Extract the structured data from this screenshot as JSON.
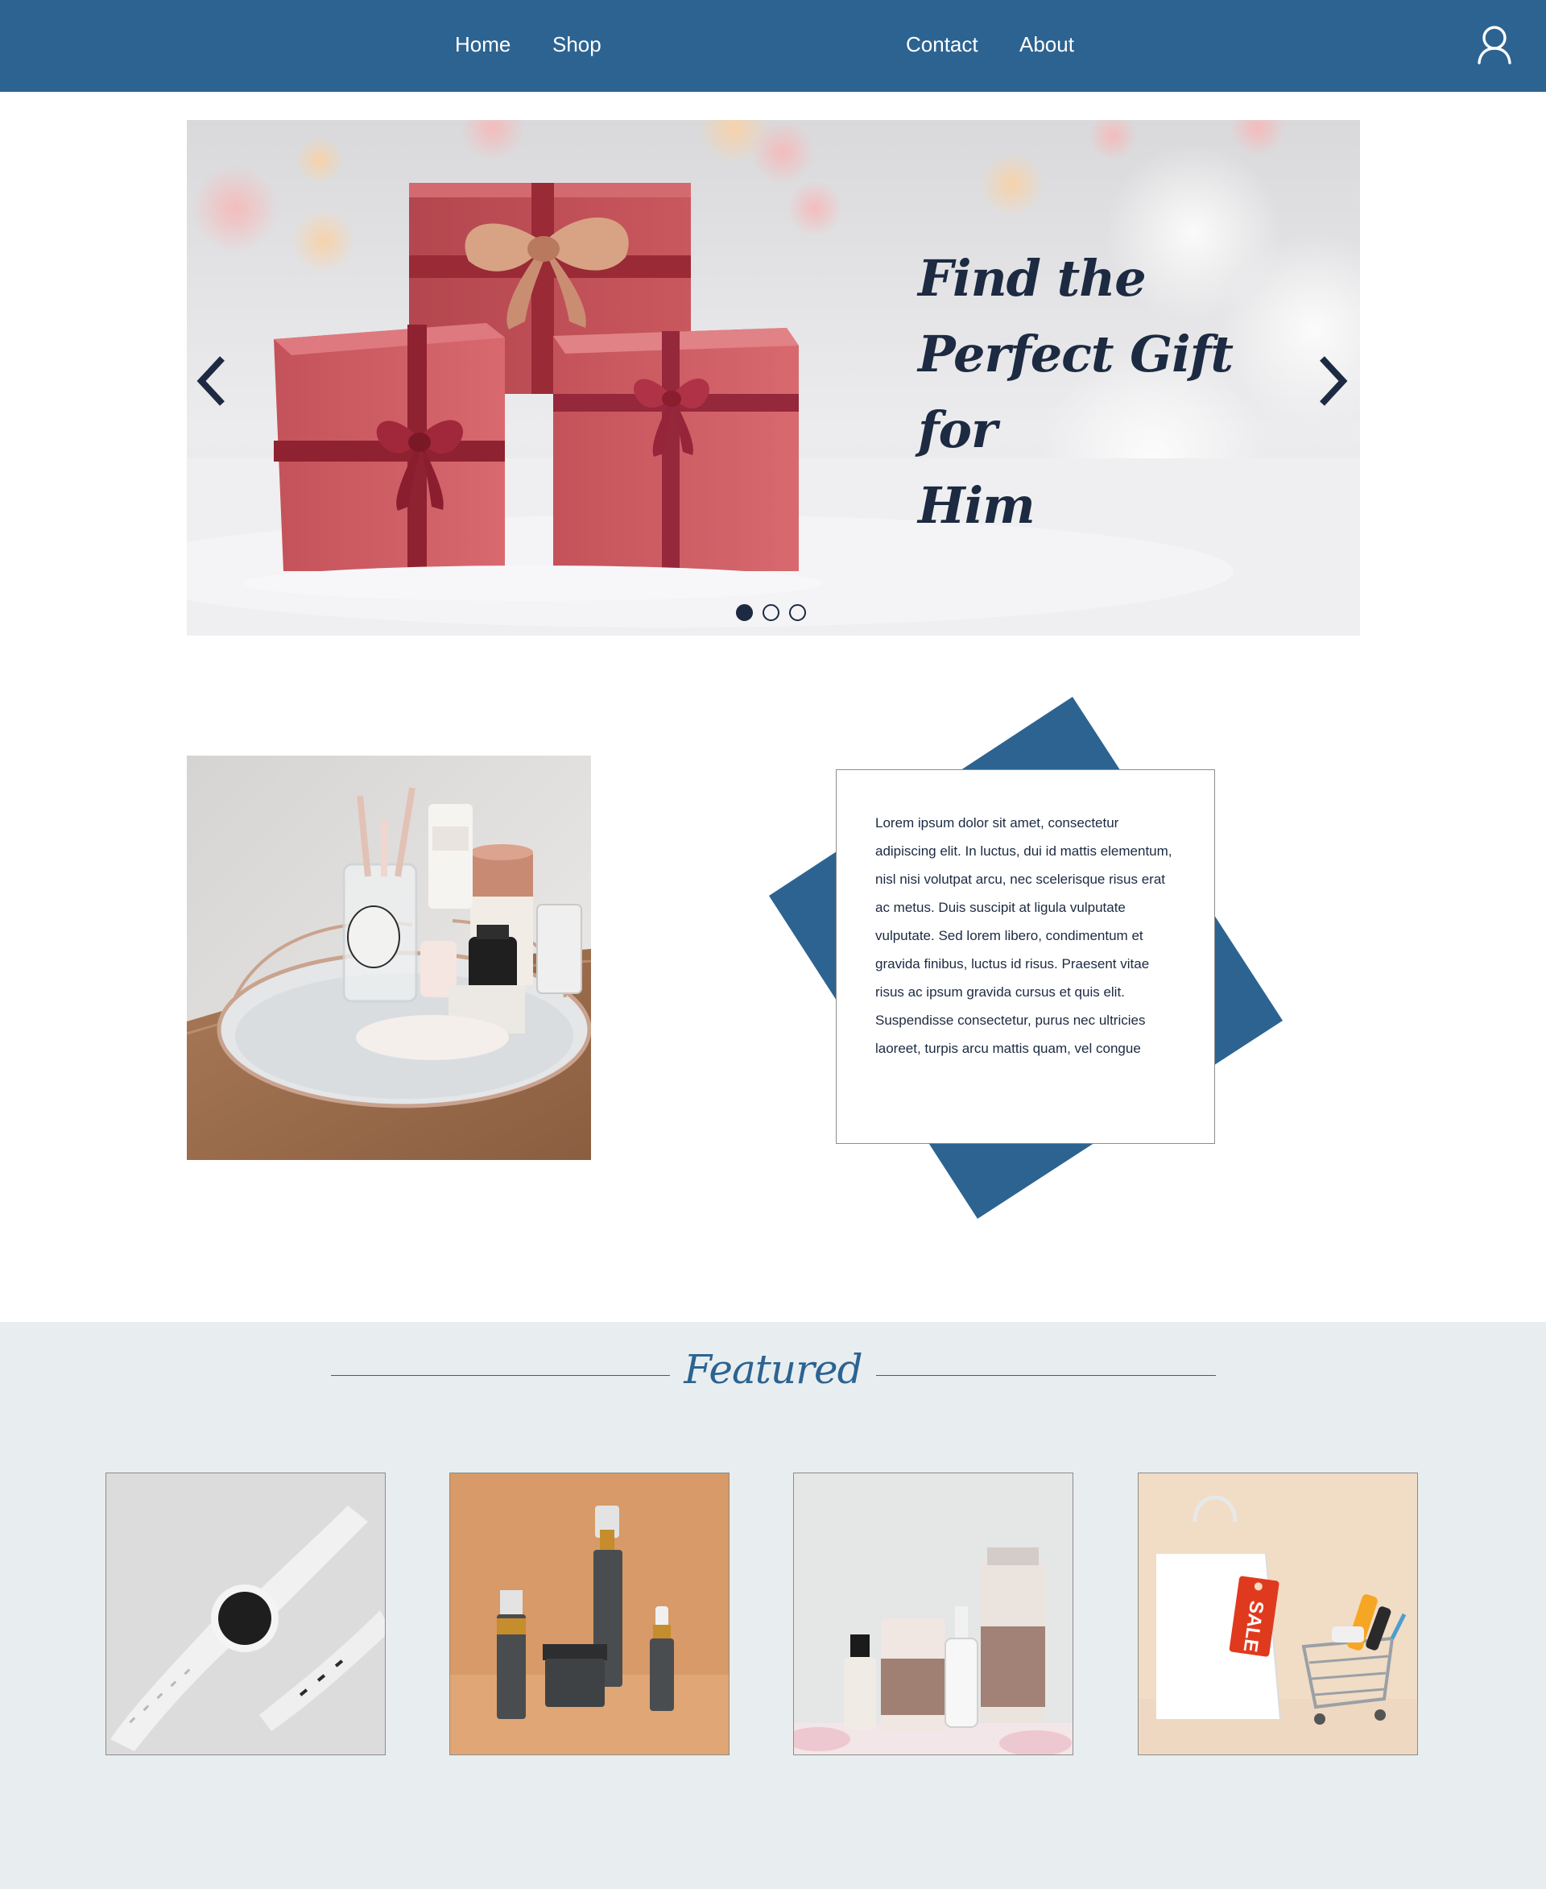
{
  "nav": {
    "links": [
      "Home",
      "Shop",
      "Contact",
      "About"
    ],
    "user_icon": "user-icon"
  },
  "hero": {
    "title_lines": [
      "Find the",
      "Perfect Gift for",
      "Him"
    ],
    "slide_count": 3,
    "active_slide": 1,
    "prev_icon": "chevron-left-icon",
    "next_icon": "chevron-right-icon"
  },
  "about": {
    "body": "Lorem ipsum dolor sit amet, consectetur adipiscing elit. In luctus, dui id mattis elementum, nisl nisi volutpat arcu, nec scelerisque risus erat ac metus. Duis suscipit at ligula vulputate vulputate. Sed lorem libero, condimentum et gravida finibus, luctus id risus. Praesent vitae risus ac ipsum gravida cursus et quis elit. Suspendisse consectetur, purus nec ultricies laoreet, turpis arcu mattis quam, vel congue"
  },
  "featured": {
    "title": "Featured",
    "products": [
      {
        "image": "smartwatch-photo"
      },
      {
        "image": "skincare-bottles-photo"
      },
      {
        "image": "skincare-tubes-photo"
      },
      {
        "image": "shopping-bag-cart-photo",
        "tag": "SALE"
      }
    ]
  },
  "colors": {
    "brand_blue": "#2c6391",
    "dark_navy": "#1c2a42",
    "featured_bg": "#e8eef0",
    "sale_red": "#e03a1e"
  }
}
